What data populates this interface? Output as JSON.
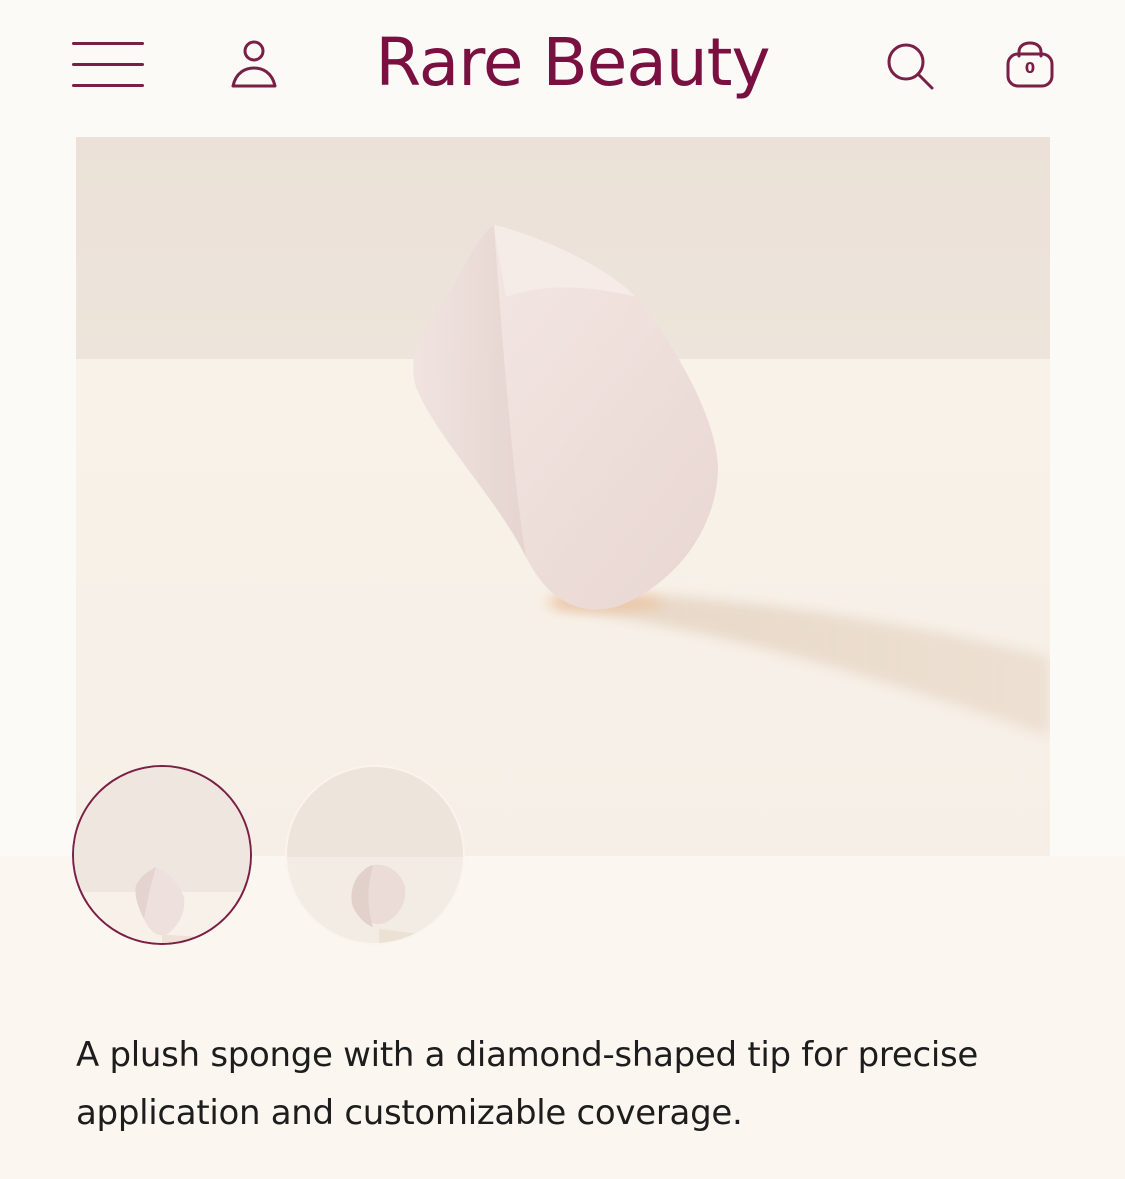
{
  "header": {
    "menu_icon": "hamburger-menu-icon",
    "account_icon": "account-icon",
    "logo_text": "Rare Beauty",
    "search_icon": "search-icon",
    "cart_icon": "shopping-bag-icon",
    "cart_count": "0"
  },
  "product": {
    "main_image": "makeup-sponge-product-photo",
    "thumbnails": [
      {
        "name": "thumbnail-1",
        "selected": true
      },
      {
        "name": "thumbnail-2",
        "selected": false
      }
    ],
    "description": "A plush sponge with a diamond-shaped tip for precise application and customizable coverage."
  },
  "colors": {
    "brand": "#7a1040",
    "text": "#1d1d1d",
    "background": "#fcf6f0"
  }
}
